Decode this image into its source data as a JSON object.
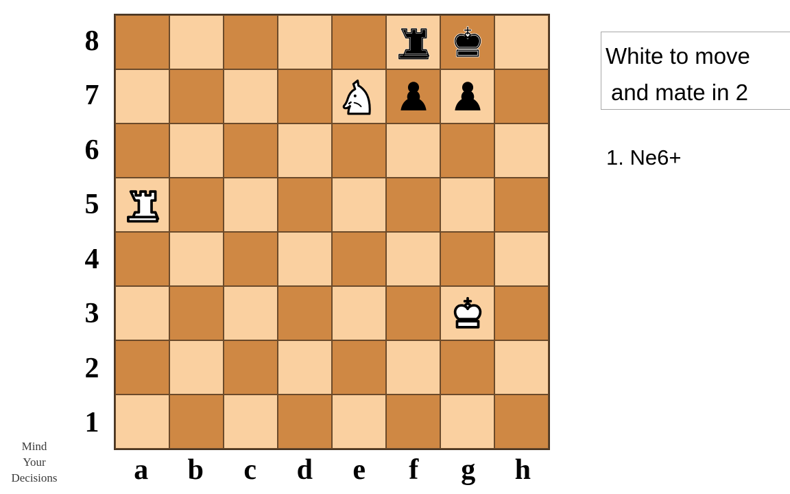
{
  "board": {
    "light_square_color": "#fad0a0",
    "dark_square_color": "#cf8844",
    "border_color": "#4a3725",
    "orientation": "white-bottom",
    "file_labels": [
      "a",
      "b",
      "c",
      "d",
      "e",
      "f",
      "g",
      "h"
    ],
    "rank_labels": [
      "8",
      "7",
      "6",
      "5",
      "4",
      "3",
      "2",
      "1"
    ],
    "pieces": [
      {
        "square": "f8",
        "color": "black",
        "type": "rook",
        "glyph": "black-rook-icon"
      },
      {
        "square": "g8",
        "color": "black",
        "type": "king",
        "glyph": "black-king-icon"
      },
      {
        "square": "e7",
        "color": "white",
        "type": "knight",
        "glyph": "white-knight-icon"
      },
      {
        "square": "f7",
        "color": "black",
        "type": "pawn",
        "glyph": "black-pawn-icon"
      },
      {
        "square": "g7",
        "color": "black",
        "type": "pawn",
        "glyph": "black-pawn-icon"
      },
      {
        "square": "a5",
        "color": "white",
        "type": "rook",
        "glyph": "white-rook-icon"
      },
      {
        "square": "g3",
        "color": "white",
        "type": "king",
        "glyph": "white-king-icon"
      }
    ]
  },
  "panel": {
    "prompt_line1": "White to move",
    "prompt_line2": "and mate in 2",
    "solution_move": "1. Ne6+"
  },
  "watermark": {
    "line1": "Mind",
    "line2": "Your",
    "line3": "Decisions"
  }
}
